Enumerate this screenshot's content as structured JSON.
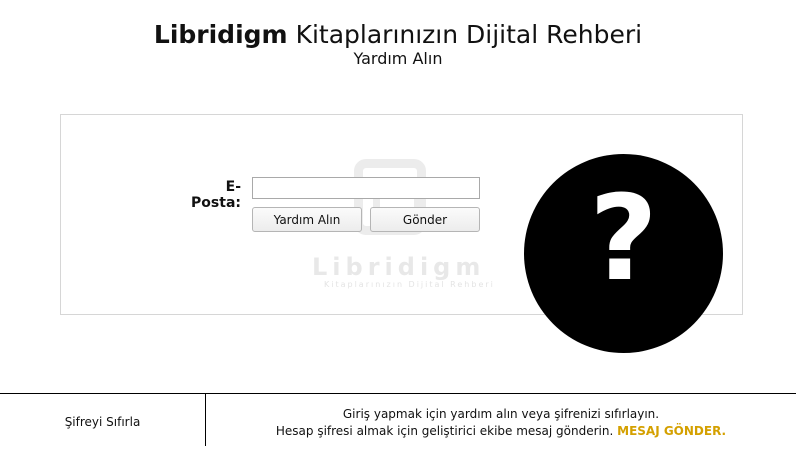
{
  "header": {
    "brand": "Libridigm",
    "title_rest": "Kitaplarınızın Dijital Rehberi",
    "subtitle": "Yardım Alın"
  },
  "watermark": {
    "text": "Libridigm",
    "subtext": "Kitaplarınızın Dijital Rehberi"
  },
  "form": {
    "email_label": "E-Posta:",
    "email_value": "",
    "help_button": "Yardım Alın",
    "send_button": "Gönder"
  },
  "help_graphic": {
    "symbol": "?",
    "icon": "question-mark-icon"
  },
  "footer": {
    "reset_password": "Şifreyi Sıfırla",
    "line1": "Giriş yapmak için yardım alın veya şifrenizi sıfırlayın.",
    "line2": "Hesap şifresi almak için geliştirici ekibe mesaj gönderin.",
    "send_message_link": "MESAJ GÖNDER."
  },
  "colors": {
    "link": "#d4a000",
    "circle": "#000000"
  }
}
